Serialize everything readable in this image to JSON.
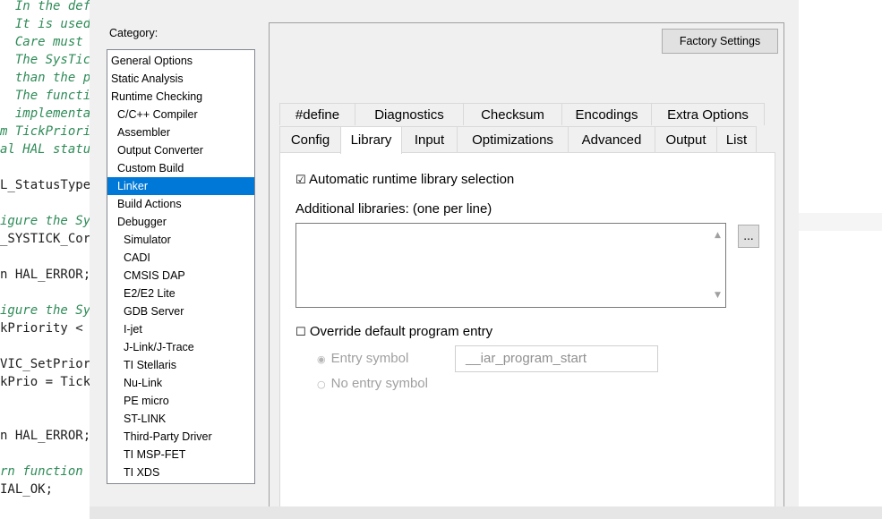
{
  "editor": {
    "lines": [
      {
        "text": "  In the defa",
        "kind": "comment"
      },
      {
        "text": "  It is used",
        "kind": "comment"
      },
      {
        "text": "  Care must b",
        "kind": "comment"
      },
      {
        "text": "  The SysTick",
        "kind": "comment"
      },
      {
        "text": "  than the pe",
        "kind": "comment"
      },
      {
        "text": "  The functic",
        "kind": "comment"
      },
      {
        "text": "  implementat",
        "kind": "comment"
      },
      {
        "text": "m TickPriori",
        "kind": "comment"
      },
      {
        "text": "al HAL statu",
        "kind": "comment"
      },
      {
        "text": "",
        "kind": "normal"
      },
      {
        "text": "L_StatusType",
        "kind": "normal"
      },
      {
        "text": "",
        "kind": "normal"
      },
      {
        "text": "igure the Sy",
        "kind": "comment"
      },
      {
        "text": "_SYSTICK_Cor",
        "kind": "normal"
      },
      {
        "text": "",
        "kind": "normal"
      },
      {
        "text": "n HAL_ERROR;",
        "kind": "normal"
      },
      {
        "text": "",
        "kind": "normal"
      },
      {
        "text": "igure the Sy",
        "kind": "comment"
      },
      {
        "text": "kPriority <",
        "kind": "normal"
      },
      {
        "text": "",
        "kind": "normal"
      },
      {
        "text": "VIC_SetPrior",
        "kind": "normal"
      },
      {
        "text": "kPrio = Tick",
        "kind": "normal"
      },
      {
        "text": "",
        "kind": "normal"
      },
      {
        "text": "",
        "kind": "normal"
      },
      {
        "text": "n HAL_ERROR;",
        "kind": "normal"
      },
      {
        "text": "",
        "kind": "normal"
      },
      {
        "text": "rn function",
        "kind": "comment"
      },
      {
        "text": "IAL_OK;",
        "kind": "normal"
      }
    ]
  },
  "category": {
    "label": "Category:",
    "items": [
      {
        "label": "General Options",
        "indent": 0
      },
      {
        "label": "Static Analysis",
        "indent": 0
      },
      {
        "label": "Runtime Checking",
        "indent": 0
      },
      {
        "label": "C/C++ Compiler",
        "indent": 1
      },
      {
        "label": "Assembler",
        "indent": 1
      },
      {
        "label": "Output Converter",
        "indent": 1
      },
      {
        "label": "Custom Build",
        "indent": 1
      },
      {
        "label": "Linker",
        "indent": 1,
        "selected": true
      },
      {
        "label": "Build Actions",
        "indent": 1
      },
      {
        "label": "Debugger",
        "indent": 1
      },
      {
        "label": "Simulator",
        "indent": 2
      },
      {
        "label": "CADI",
        "indent": 2
      },
      {
        "label": "CMSIS DAP",
        "indent": 2
      },
      {
        "label": "E2/E2 Lite",
        "indent": 2
      },
      {
        "label": "GDB Server",
        "indent": 2
      },
      {
        "label": "I-jet",
        "indent": 2
      },
      {
        "label": "J-Link/J-Trace",
        "indent": 2
      },
      {
        "label": "TI Stellaris",
        "indent": 2
      },
      {
        "label": "Nu-Link",
        "indent": 2
      },
      {
        "label": "PE micro",
        "indent": 2
      },
      {
        "label": "ST-LINK",
        "indent": 2
      },
      {
        "label": "Third-Party Driver",
        "indent": 2
      },
      {
        "label": "TI MSP-FET",
        "indent": 2
      },
      {
        "label": "TI XDS",
        "indent": 2
      }
    ]
  },
  "factory_settings": "Factory Settings",
  "tabs": {
    "row1": [
      "#define",
      "Diagnostics",
      "Checksum",
      "Encodings",
      "Extra Options"
    ],
    "row2": [
      "Config",
      "Library",
      "Input",
      "Optimizations",
      "Advanced",
      "Output",
      "List"
    ],
    "active": "Library"
  },
  "library": {
    "auto_select": {
      "glyph": "☑",
      "label": "Automatic runtime library selection",
      "checked": true
    },
    "additional_label": "Additional libraries: (one per line)",
    "additional_value": "",
    "browse_label": "...",
    "override": {
      "glyph": "☐",
      "label": "Override default program entry",
      "checked": false
    },
    "entry_symbol": {
      "glyph": "◉",
      "label": "Entry symbol",
      "selected": true
    },
    "entry_value": "__iar_program_start",
    "no_entry_symbol": {
      "glyph": "○",
      "label": "No entry symbol",
      "selected": false
    }
  },
  "colors": {
    "selection": "#0078d7",
    "dialog_bg": "#f0f0f0",
    "comment": "#2e8b57",
    "disabled_text": "#a0a0a0"
  }
}
